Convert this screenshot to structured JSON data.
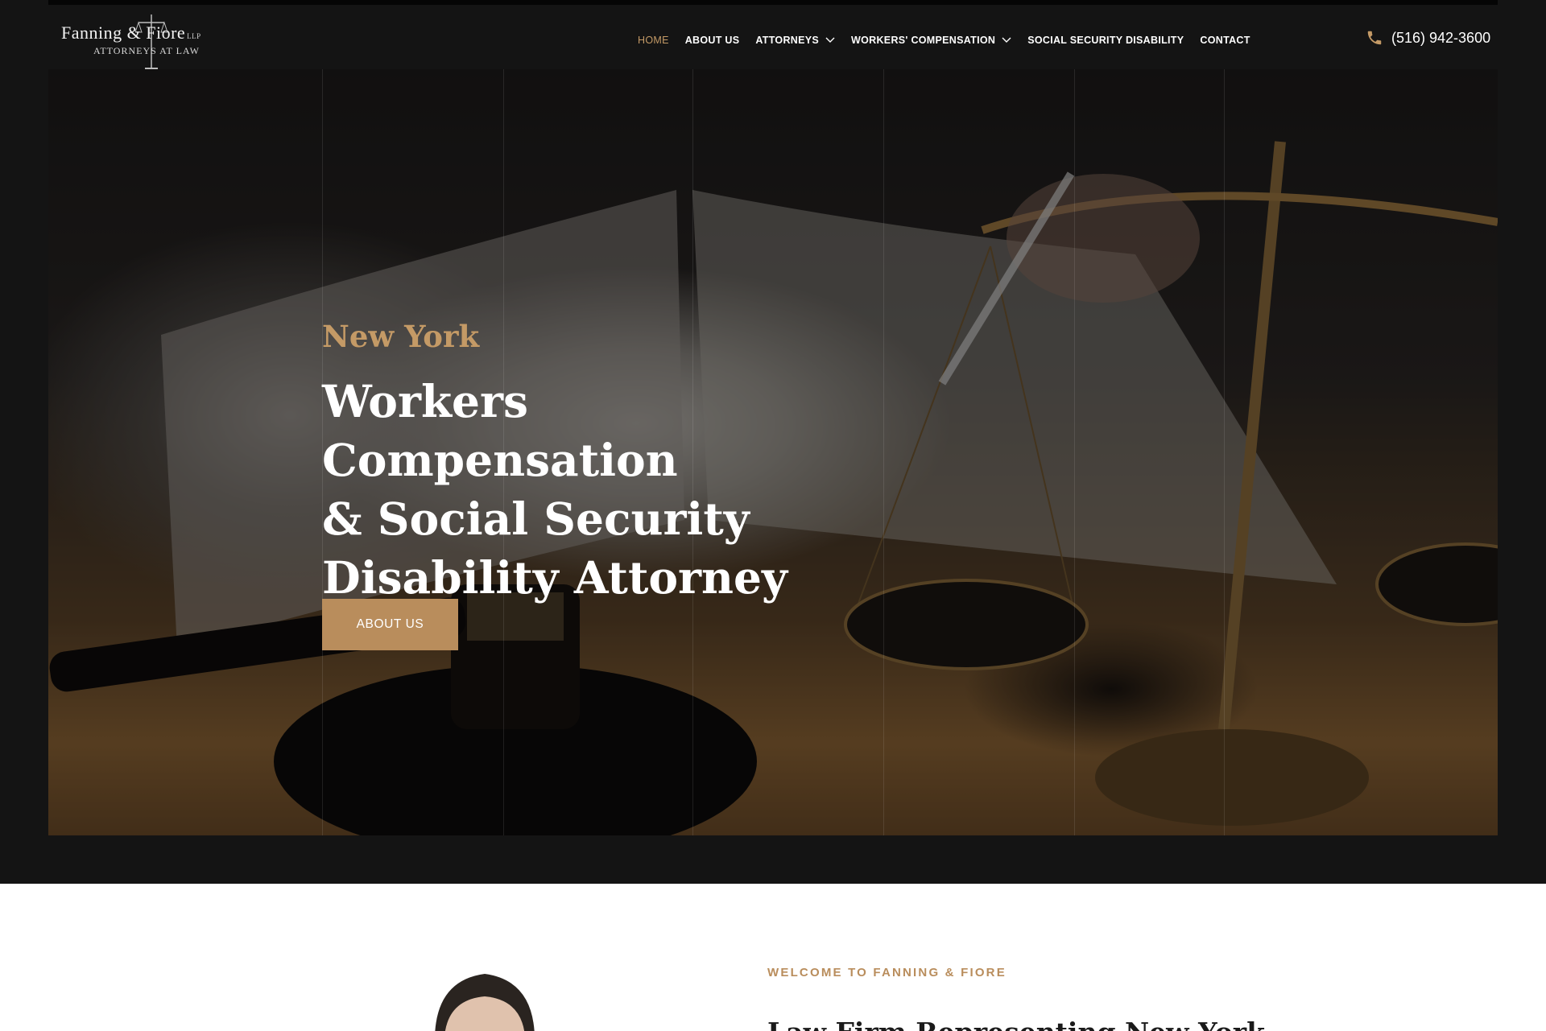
{
  "header": {
    "logo": {
      "name": "Fanning & Fiore",
      "suffix": "LLP",
      "tagline": "ATTORNEYS AT LAW"
    },
    "nav": [
      {
        "label": "HOME",
        "active": true
      },
      {
        "label": "ABOUT US",
        "active": false
      },
      {
        "label": "ATTORNEYS",
        "active": false,
        "dropdown": true
      },
      {
        "label": "WORKERS' COMPENSATION",
        "active": false,
        "dropdown": true
      },
      {
        "label": "SOCIAL SECURITY DISABILITY",
        "active": false
      },
      {
        "label": "CONTACT",
        "active": false
      }
    ],
    "phone": "(516) 942-3600"
  },
  "hero": {
    "eyebrow": "New York",
    "headline_lines": [
      "Workers Compensation",
      "& Social Security",
      "Disability Attorney"
    ],
    "button_label": "ABOUT US"
  },
  "intro": {
    "eyebrow": "WELCOME TO FANNING & FIORE",
    "title": "Law Firm Representing New York"
  },
  "colors": {
    "accent": "#c49a66",
    "button": "#b98d5c",
    "dark_bg": "#141414",
    "text_light": "#ffffff",
    "text_dark": "#1a1a1a"
  },
  "icons": [
    "phone-icon",
    "chevron-down-icon",
    "scales-of-justice-icon"
  ]
}
